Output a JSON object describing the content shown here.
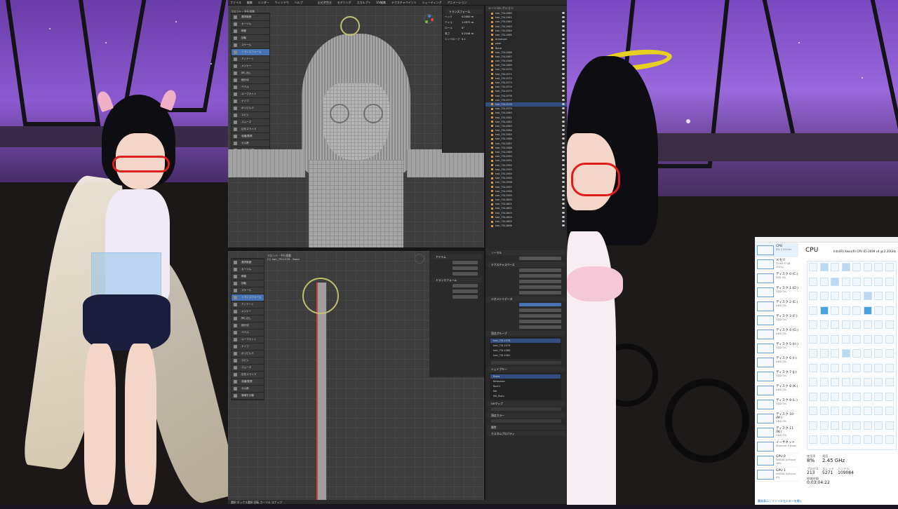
{
  "blender": {
    "top_menu": [
      "ファイル",
      "編集",
      "レンダー",
      "ウィンドウ",
      "ヘルプ"
    ],
    "workspace_tabs": [
      "レイアウト",
      "モデリング",
      "スカルプト",
      "UV編集",
      "テクスチャペイント",
      "シェーディング",
      "アニメーション",
      "レンダリング",
      "コンポジット",
      "ジオメトリノード",
      "スクリプト"
    ],
    "upper_viewport": {
      "header_left": "フロント・平行投影",
      "header_sub": "(1) hair_TSL1578 - Bone"
    },
    "lower_viewport": {
      "header_left": "フロント・平行投影",
      "header_sub": "(1) hair_TSL1578 - Bone",
      "mode": "編集モード"
    },
    "toolbar_items": [
      "選択範囲",
      "カーソル",
      "移動",
      "回転",
      "スケール",
      "トランスフォーム",
      "アノテート",
      "メジャー",
      "押し出し",
      "細分化",
      "ベベル",
      "ループカット",
      "ナイフ",
      "ポリビルド",
      "スピン",
      "スムーズ",
      "辺をスライド",
      "収縮/膨張",
      "せん断",
      "領域を分離"
    ],
    "n_panel": {
      "tab": "アイテム",
      "transform_label": "トランスフォーム",
      "fields": [
        "ヘッド",
        "テイル",
        "ロール",
        "長さ",
        "エンベロープ"
      ],
      "values": [
        "0.0000 m",
        "1.0571 m",
        "0°",
        "0.2144 m",
        "0.1"
      ]
    },
    "outliner": {
      "title": "シーンコレクション",
      "rows": [
        "hair_TSL1560",
        "hair_TSL1561",
        "hair_TSL1562",
        "hair_TSL1563",
        "hair_TSL1564",
        "hair_TSL1565",
        "Armature",
        "pose",
        "Bone",
        "hair_TSL1566",
        "hair_TSL1567",
        "hair_TSL1568",
        "hair_TSL1569",
        "hair_TSL1570",
        "hair_TSL1571",
        "hair_TSL1572",
        "hair_TSL1573",
        "hair_TSL1574",
        "hair_TSL1575",
        "hair_TSL1576",
        "hair_TSL1577",
        "hair_TSL1578",
        "hair_TSL1579",
        "hair_TSL1580",
        "hair_TSL1581",
        "hair_TSL1582",
        "hair_TSL1583",
        "hair_TSL1584",
        "hair_TSL1585",
        "hair_TSL1586",
        "hair_TSL1587",
        "hair_TSL1588",
        "hair_TSL1589",
        "hair_TSL1590",
        "hair_TSL1591",
        "hair_TSL1592",
        "hair_TSL1593",
        "hair_TSL1594",
        "hair_TSL1595",
        "hair_TSL1596",
        "hair_TSL1597",
        "hair_TSL1598",
        "hair_TSL1599",
        "hair_TSL1600",
        "hair_TSL1601",
        "hair_TSL1602",
        "hair_TSL1603",
        "hair_TSL1604",
        "hair_TSL1605",
        "hair_TSL1606"
      ],
      "selected_index": 21
    },
    "properties": {
      "sections": [
        "ノーマル",
        "テクスチャスペース",
        "ジオメトリデータ",
        "頂点グループ",
        "シェイプキー",
        "UVマップ",
        "頂点カラー",
        "属性",
        "カスタムプロパティ"
      ],
      "vertex_groups": [
        "hair_TSL1578",
        "hair_TSL1579",
        "hair_TSL1580",
        "hair_TSL1581"
      ],
      "shape_keys": [
        "Basis",
        "Kirenaise",
        "Kuchi",
        "Me",
        "Me_Bosu"
      ]
    },
    "statusbar": "選択  ボックス選択  回転  カーソル  スナップ"
  },
  "taskmanager": {
    "title": "CPU",
    "cpu_model": "Intel(R) Xeon(R) CPU E5-2699 v4 @ 2.20GHz",
    "sidebar": [
      {
        "name": "CPU",
        "detail": "8% 2.45GHz"
      },
      {
        "name": "メモリ",
        "detail": "22/63.9 GB (35%)"
      },
      {
        "name": "ディスク 0 (C:)",
        "detail": "SSD 0%"
      },
      {
        "name": "ディスク 1 (D:)",
        "detail": "HDD 0%"
      },
      {
        "name": "ディスク 2 (E:)",
        "detail": "HDD 0%"
      },
      {
        "name": "ディスク 3 (F:)",
        "detail": "HDD 0%"
      },
      {
        "name": "ディスク 4 (G:)",
        "detail": "HDD 0%"
      },
      {
        "name": "ディスク 5 (H:)",
        "detail": "HDD 0%"
      },
      {
        "name": "ディスク 6 (I:)",
        "detail": "HDD 0%"
      },
      {
        "name": "ディスク 7 (J:)",
        "detail": "HDD 0%"
      },
      {
        "name": "ディスク 8 (K:)",
        "detail": "HDD 0%"
      },
      {
        "name": "ディスク 9 (L:)",
        "detail": "HDD 0%"
      },
      {
        "name": "ディスク 10 (M:)",
        "detail": "HDD 0%"
      },
      {
        "name": "ディスク 11 (N:)",
        "detail": "HDD 0%"
      },
      {
        "name": "イーサネット",
        "detail": "Ethernet 0 Kbps"
      },
      {
        "name": "GPU 0",
        "detail": "NVIDIA GeForce 38%"
      },
      {
        "name": "GPU 1",
        "detail": "NVIDIA GeForce 0%"
      }
    ],
    "stats": {
      "usage_label": "使用率",
      "usage": "8%",
      "speed_label": "速度",
      "speed": "2.45 GHz",
      "processes_label": "プロセス",
      "processes": "213",
      "threads_label": "スレッド",
      "threads": "5271",
      "handles_label": "ハンドル",
      "handles": "109084",
      "uptime_label": "稼働時間",
      "uptime": "0:03:04:22"
    },
    "footer": "簡易表示 | リソースモニターを開く"
  }
}
